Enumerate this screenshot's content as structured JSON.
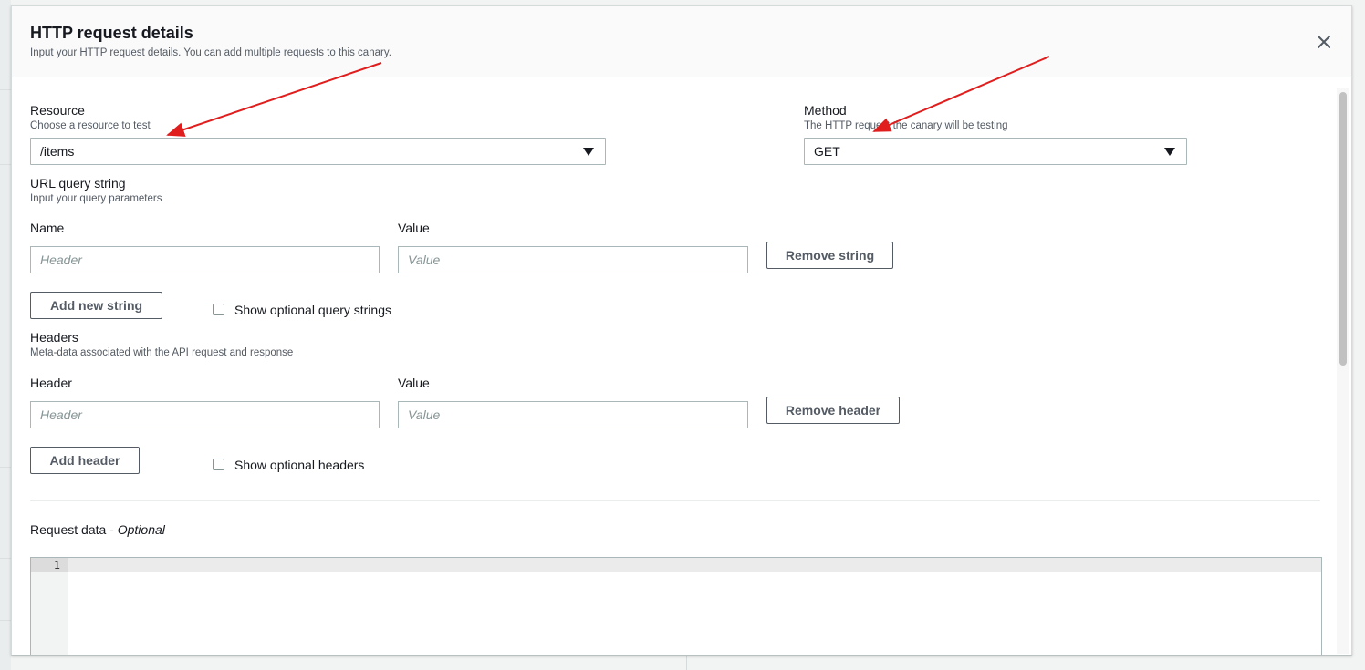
{
  "modal": {
    "title": "HTTP request details",
    "description": "Input your HTTP request details. You can add multiple requests to this canary."
  },
  "resource": {
    "label": "Resource",
    "description": "Choose a resource to test",
    "value": "/items"
  },
  "method": {
    "label": "Method",
    "description": "The HTTP request the canary will be testing",
    "value": "GET"
  },
  "query_string": {
    "label": "URL query string",
    "description": "Input your query parameters",
    "name_label": "Name",
    "value_label": "Value",
    "name_placeholder": "Header",
    "value_placeholder": "Value",
    "remove_label": "Remove string",
    "add_label": "Add new string",
    "optional_label": "Show optional query strings"
  },
  "headers": {
    "label": "Headers",
    "description": "Meta-data associated with the API request and response",
    "header_label": "Header",
    "value_label": "Value",
    "header_placeholder": "Header",
    "value_placeholder": "Value",
    "remove_label": "Remove header",
    "add_label": "Add header",
    "optional_label": "Show optional headers"
  },
  "request_data": {
    "label": "Request data - ",
    "optional": "Optional",
    "line_number": "1"
  },
  "annotations": {
    "arrow_color": "#e01e1e"
  }
}
